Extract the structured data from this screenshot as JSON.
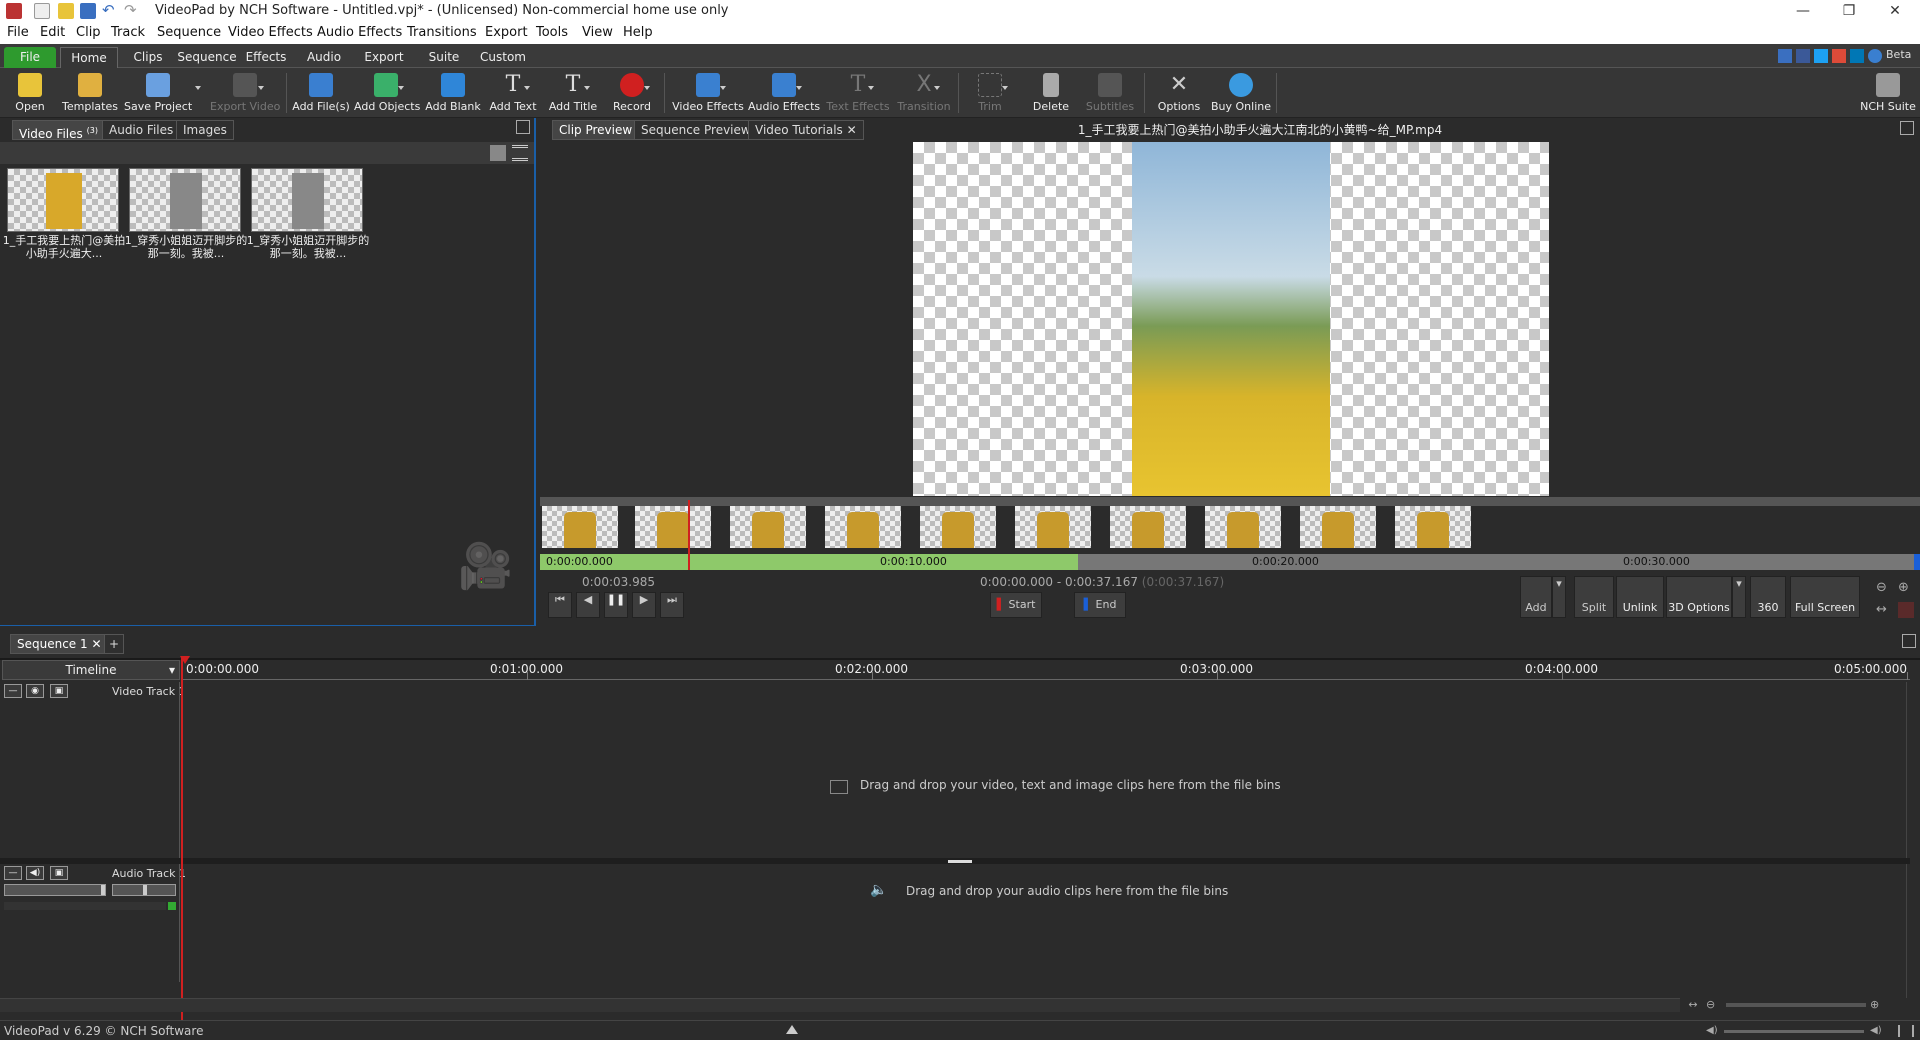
{
  "window": {
    "title": "VideoPad by NCH Software - Untitled.vpj* - (Unlicensed) Non-commercial home use only"
  },
  "menu": [
    "File",
    "Edit",
    "Clip",
    "Track",
    "Sequence",
    "Video Effects",
    "Audio Effects",
    "Transitions",
    "Export",
    "Tools",
    "View",
    "Help"
  ],
  "ribbon_tabs": [
    "File",
    "Home",
    "Clips",
    "Sequence",
    "Effects",
    "Audio",
    "Export",
    "Suite",
    "Custom"
  ],
  "beta_label": "Beta",
  "ribbon_buttons": [
    {
      "label": "Open",
      "icon": "folder-open-icon",
      "color": "#e8c43a"
    },
    {
      "label": "Templates",
      "icon": "templates-icon",
      "color": "#e0b040"
    },
    {
      "label": "Save Project",
      "icon": "save-icon",
      "color": "#6aa0e0"
    },
    {
      "label": "Export Video",
      "icon": "export-video-icon",
      "color": "#666666"
    },
    {
      "label": "Add File(s)",
      "icon": "add-files-icon",
      "color": "#3a7fd0"
    },
    {
      "label": "Add Objects",
      "icon": "add-objects-icon",
      "color": "#3ab06a"
    },
    {
      "label": "Add Blank",
      "icon": "add-blank-icon",
      "color": "#2f86d8"
    },
    {
      "label": "Add Text",
      "icon": "add-text-icon",
      "color": "#dddddd"
    },
    {
      "label": "Add Title",
      "icon": "add-title-icon",
      "color": "#dddddd"
    },
    {
      "label": "Record",
      "icon": "record-icon",
      "color": "#d02020"
    },
    {
      "label": "Video Effects",
      "icon": "video-effects-icon",
      "color": "#3a80d0"
    },
    {
      "label": "Audio Effects",
      "icon": "audio-effects-icon",
      "color": "#3a80d0"
    },
    {
      "label": "Text Effects",
      "icon": "text-effects-icon",
      "color": "#777777"
    },
    {
      "label": "Transition",
      "icon": "transition-icon",
      "color": "#777777"
    },
    {
      "label": "Trim",
      "icon": "trim-icon",
      "color": "#777777"
    },
    {
      "label": "Delete",
      "icon": "delete-icon",
      "color": "#cccccc"
    },
    {
      "label": "Subtitles",
      "icon": "subtitles-icon",
      "color": "#777777"
    },
    {
      "label": "Options",
      "icon": "options-icon",
      "color": "#cccccc"
    },
    {
      "label": "Buy Online",
      "icon": "buy-online-icon",
      "color": "#3a9ae0"
    },
    {
      "label": "NCH Suite",
      "icon": "nch-suite-icon",
      "color": "#cccccc"
    }
  ],
  "bins": {
    "tabs": [
      "Video Files",
      "Audio Files",
      "Images"
    ],
    "video_count": "(3)",
    "files": [
      {
        "name": "1_手工我要上热门@美拍小助手火遍大..."
      },
      {
        "name": "1_穿秀小姐姐迈开脚步的那一刻。我被..."
      },
      {
        "name": "1_穿秀小姐姐迈开脚步的那一刻。我被..."
      }
    ]
  },
  "preview": {
    "tabs": [
      "Clip Preview",
      "Sequence Preview",
      "Video Tutorials"
    ],
    "clip_title": "1_手工我要上热门@美拍小助手火遍大江南北的小黄鸭~给_MP.mp4",
    "ruler_labels": [
      "0:00:00.000",
      "0:00:10.000",
      "0:00:20.000",
      "0:00:30.000"
    ],
    "current_time": "0:00:03.985",
    "range_start": "0:00:00.000",
    "range_sep": "-",
    "range_end": "0:00:37.167",
    "range_duration": "(0:00:37.167)",
    "start_label": "Start",
    "end_label": "End",
    "add_label": "Add",
    "split_label": "Split",
    "unlink_label": "Unlink",
    "options3d_label": "3D Options",
    "label_360": "360",
    "fullscreen_label": "Full Screen"
  },
  "sequence": {
    "tab": "Sequence 1",
    "mode": "Timeline",
    "ruler_labels": [
      "0:00:00.000",
      "0:01:00.000",
      "0:02:00.000",
      "0:03:00.000",
      "0:04:00.000",
      "0:05:00.000"
    ],
    "video_track": "Video Track 1",
    "audio_track": "Audio Track 1",
    "video_hint": "Drag and drop your video, text and image clips here from the file bins",
    "audio_hint": "Drag and drop your audio clips here from the file bins"
  },
  "status": {
    "version": "VideoPad v 6.29 © NCH Software"
  }
}
